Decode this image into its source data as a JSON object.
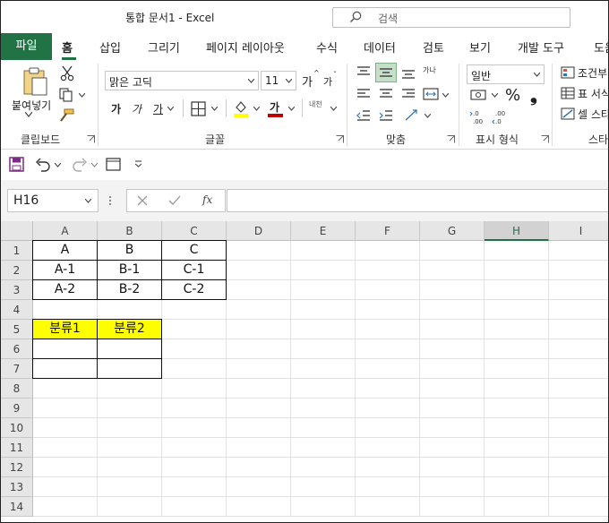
{
  "window": {
    "title": "통합 문서1  -  Excel"
  },
  "search": {
    "placeholder": "검색"
  },
  "ribbon_tabs": {
    "file": "파일",
    "home": "홈",
    "insert": "삽입",
    "draw": "그리기",
    "page_layout": "페이지 레이아웃",
    "formulas": "수식",
    "data": "데이터",
    "review": "검토",
    "view": "보기",
    "developer": "개발 도구",
    "help_partial": "도움"
  },
  "ribbon": {
    "clipboard": {
      "paste_label": "붙여넣기",
      "group_label": "클립보드"
    },
    "font": {
      "font_name": "맑은 고딕",
      "font_size": "11",
      "group_label": "글꼴",
      "bold": "가",
      "italic": "가",
      "underline": "가",
      "font_color_glyph": "가",
      "grow": "가",
      "shrink": "가",
      "phonetic": "내천"
    },
    "alignment": {
      "group_label": "맞춤",
      "wrap": "가나"
    },
    "number": {
      "format": "일반",
      "group_label": "표시 형식",
      "percent": "%",
      "comma": "❟"
    },
    "styles": {
      "conditional": "조건부",
      "table": "표 서식",
      "cell_styles": "셀 스타",
      "group_label_partial": "스타"
    },
    "colors": {
      "accent": "#217346",
      "highlight": "#ffff00",
      "font_red": "#c00000"
    }
  },
  "formula_bar": {
    "name_box": "H16",
    "fx": "fx",
    "value": ""
  },
  "sheet": {
    "columns": [
      "A",
      "B",
      "C",
      "D",
      "E",
      "F",
      "G",
      "H",
      "I"
    ],
    "selected_column": "H",
    "rows": [
      "1",
      "2",
      "3",
      "4",
      "5",
      "6",
      "7",
      "8",
      "9",
      "10",
      "11",
      "12",
      "13",
      "14"
    ],
    "cells": {
      "A1": "A",
      "B1": "B",
      "C1": "C",
      "A2": "A-1",
      "B2": "B-1",
      "C2": "C-1",
      "A3": "A-2",
      "B3": "B-2",
      "C3": "C-2",
      "A5": "분류1",
      "B5": "분류2"
    }
  }
}
